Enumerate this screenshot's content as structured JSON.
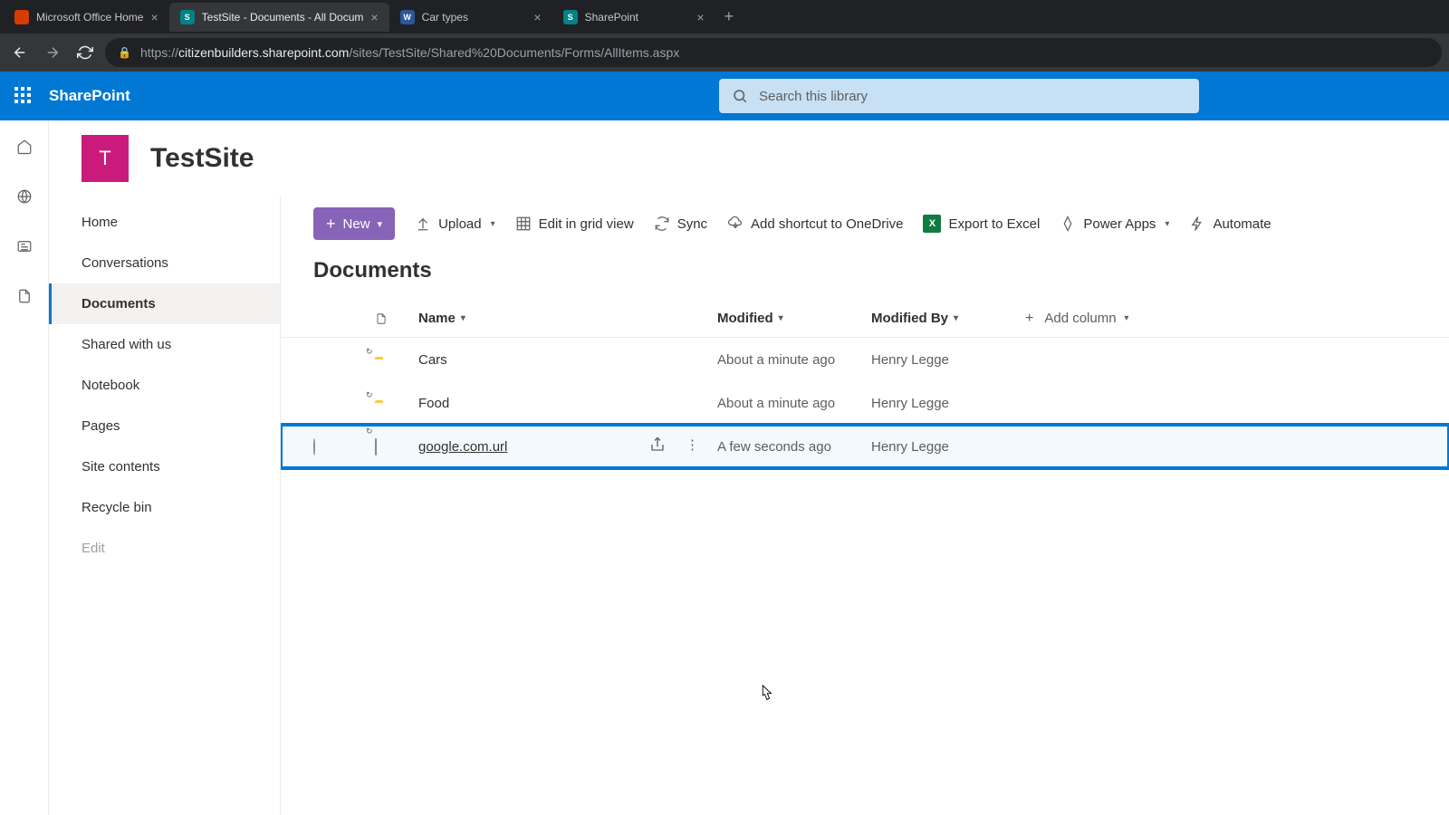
{
  "browser": {
    "tabs": [
      {
        "favicon": "office",
        "title": "Microsoft Office Home",
        "active": false
      },
      {
        "favicon": "sp",
        "title": "TestSite - Documents - All Docum",
        "active": true
      },
      {
        "favicon": "word",
        "title": "Car types",
        "active": false
      },
      {
        "favicon": "sp",
        "title": "SharePoint",
        "active": false
      }
    ],
    "url": {
      "host": "citizenbuilders.sharepoint.com",
      "path": "/sites/TestSite/Shared%20Documents/Forms/AllItems.aspx"
    }
  },
  "suite": {
    "app_name": "SharePoint",
    "search_placeholder": "Search this library"
  },
  "site": {
    "logo_letter": "T",
    "title": "TestSite"
  },
  "sidenav": {
    "items": [
      "Home",
      "Conversations",
      "Documents",
      "Shared with us",
      "Notebook",
      "Pages",
      "Site contents",
      "Recycle bin"
    ],
    "active_index": 2,
    "edit_label": "Edit"
  },
  "toolbar": {
    "new_label": "New",
    "upload_label": "Upload",
    "grid_label": "Edit in grid view",
    "sync_label": "Sync",
    "shortcut_label": "Add shortcut to OneDrive",
    "export_label": "Export to Excel",
    "powerapps_label": "Power Apps",
    "automate_label": "Automate"
  },
  "library": {
    "heading": "Documents",
    "columns": {
      "name": "Name",
      "modified": "Modified",
      "modified_by": "Modified By",
      "add_column": "Add column"
    },
    "rows": [
      {
        "type": "folder",
        "name": "Cars",
        "modified": "About a minute ago",
        "modified_by": "Henry Legge",
        "highlighted": false
      },
      {
        "type": "folder",
        "name": "Food",
        "modified": "About a minute ago",
        "modified_by": "Henry Legge",
        "highlighted": false
      },
      {
        "type": "link",
        "name": "google.com.url",
        "modified": "A few seconds ago",
        "modified_by": "Henry Legge",
        "highlighted": true
      }
    ]
  }
}
